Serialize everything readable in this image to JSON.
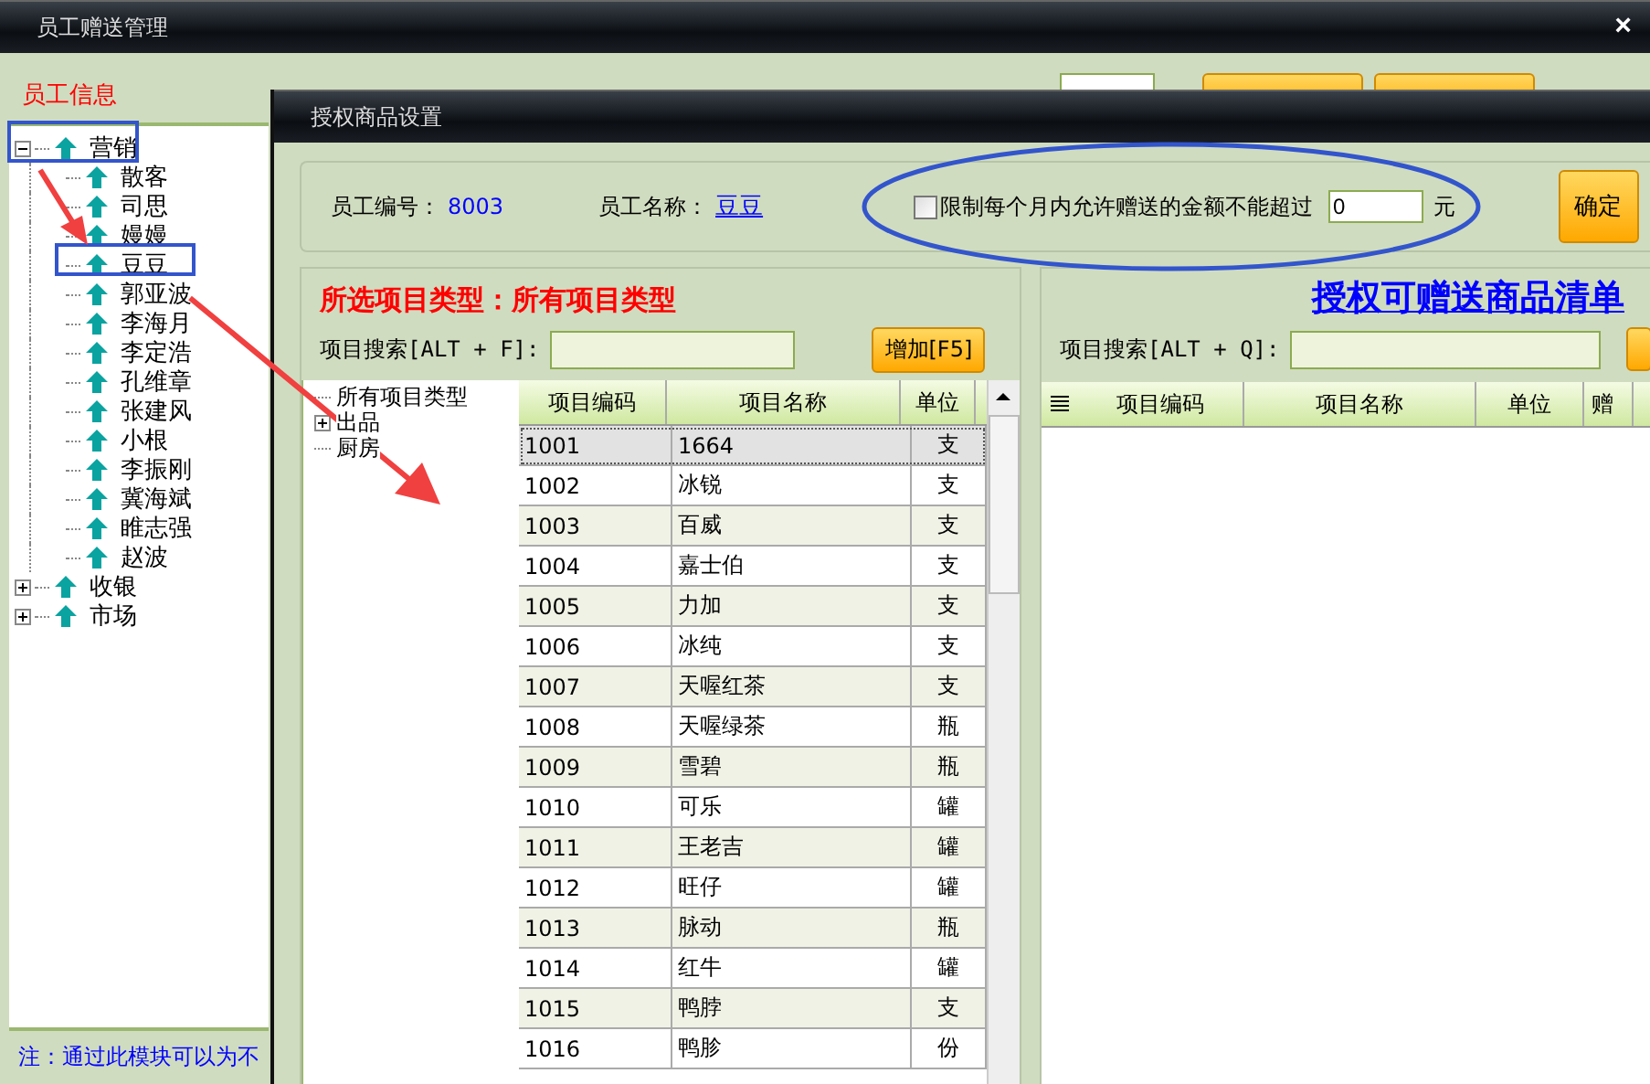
{
  "main_window": {
    "title": "员工赠送管理",
    "close": "×"
  },
  "employee_panel": {
    "title": "员工信息",
    "note": "注：通过此模块可以为不",
    "tree": [
      {
        "label": "营销",
        "expanded": true,
        "children": [
          {
            "label": "散客"
          },
          {
            "label": "司思"
          },
          {
            "label": "嫚嫚"
          },
          {
            "label": "豆豆"
          },
          {
            "label": "郭亚波"
          },
          {
            "label": "李海月"
          },
          {
            "label": "李定浩"
          },
          {
            "label": "孔维章"
          },
          {
            "label": "张建风"
          },
          {
            "label": "小根"
          },
          {
            "label": "李振刚"
          },
          {
            "label": "冀海斌"
          },
          {
            "label": "睢志强"
          },
          {
            "label": "赵波"
          }
        ]
      },
      {
        "label": "收银",
        "expanded": false
      },
      {
        "label": "市场",
        "expanded": false
      }
    ]
  },
  "dialog": {
    "title": "授权商品设置",
    "info": {
      "employee_id_label": "员工编号：",
      "employee_id": "8003",
      "employee_name_label": "员工名称：",
      "employee_name": "豆豆",
      "limit_checked": false,
      "limit_label": "限制每个月内允许赠送的金额不能超过",
      "limit_value": "0",
      "unit": "元",
      "confirm": "确定"
    },
    "left": {
      "heading": "所选项目类型：所有项目类型",
      "search_label": "项目搜索[ALT + F]:",
      "add_button": "增加[F5]",
      "type_tree": [
        {
          "label": "所有项目类型",
          "kind": "leaf"
        },
        {
          "label": "出品",
          "kind": "folder",
          "expanded": false
        },
        {
          "label": "厨房",
          "kind": "leaf"
        }
      ],
      "columns": [
        "项目编码",
        "项目名称",
        "单位"
      ],
      "rows": [
        {
          "code": "1001",
          "name": "1664",
          "unit": "支",
          "selected": true
        },
        {
          "code": "1002",
          "name": "冰锐",
          "unit": "支",
          "selected": false
        },
        {
          "code": "1003",
          "name": "百威",
          "unit": "支",
          "selected": false
        },
        {
          "code": "1004",
          "name": "嘉士伯",
          "unit": "支",
          "selected": false
        },
        {
          "code": "1005",
          "name": "力加",
          "unit": "支",
          "selected": false
        },
        {
          "code": "1006",
          "name": "冰纯",
          "unit": "支",
          "selected": false
        },
        {
          "code": "1007",
          "name": "天喔红茶",
          "unit": "支",
          "selected": false
        },
        {
          "code": "1008",
          "name": "天喔绿茶",
          "unit": "瓶",
          "selected": false
        },
        {
          "code": "1009",
          "name": "雪碧",
          "unit": "瓶",
          "selected": false
        },
        {
          "code": "1010",
          "name": "可乐",
          "unit": "罐",
          "selected": false
        },
        {
          "code": "1011",
          "name": "王老吉",
          "unit": "罐",
          "selected": false
        },
        {
          "code": "1012",
          "name": "旺仔",
          "unit": "罐",
          "selected": false
        },
        {
          "code": "1013",
          "name": "脉动",
          "unit": "瓶",
          "selected": false
        },
        {
          "code": "1014",
          "name": "红牛",
          "unit": "罐",
          "selected": false
        },
        {
          "code": "1015",
          "name": "鸭脖",
          "unit": "支",
          "selected": false
        },
        {
          "code": "1016",
          "name": "鸭胗",
          "unit": "份",
          "selected": false
        }
      ]
    },
    "right": {
      "heading": "授权可赠送商品清单",
      "search_label": "项目搜索[ALT + Q]:",
      "columns": [
        "项目编码",
        "项目名称",
        "单位",
        "赠"
      ]
    }
  }
}
